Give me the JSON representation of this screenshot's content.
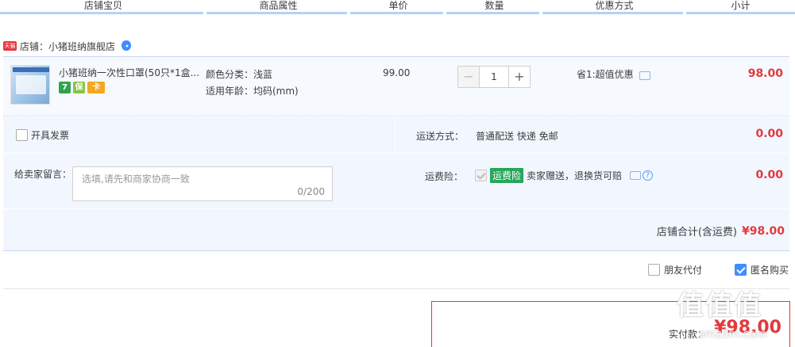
{
  "header": {
    "columns": [
      "店铺宝贝",
      "商品属性",
      "单价",
      "数量",
      "优惠方式",
      "小计"
    ]
  },
  "shop": {
    "badge": "天猫",
    "name": "店铺：小猪班纳旗舰店"
  },
  "item": {
    "title": "小猪班纳一次性口罩(50只*1盒...",
    "badges": [
      "7",
      "保",
      "卡"
    ],
    "attr_color": "颜色分类：浅蓝",
    "attr_age": "适用年龄：均码(mm)",
    "unit_price": "99.00",
    "quantity": "1",
    "minus": "−",
    "plus": "+",
    "promo": "省1:超值优惠",
    "subtotal": "98.00"
  },
  "options": {
    "invoice_label": "开具发票",
    "delivery_label": "运送方式：",
    "delivery_value": "普通配送 快递 免邮",
    "delivery_fee": "0.00",
    "message_label": "给卖家留言：",
    "message_placeholder": "选填,请先和商家协商一致",
    "message_count": "0/200",
    "insurance_label": "运费险：",
    "insurance_tag": "运费险",
    "insurance_text": "卖家赠送，退换货可赔",
    "insurance_help": "?",
    "insurance_fee": "0.00",
    "total_label": "店铺合计(含运费)",
    "total_value": "¥98.00"
  },
  "footer": {
    "friend_pay": "朋友代付",
    "anonymous": "匿名购买",
    "pay_label": "实付款：",
    "pay_value": "¥98.00"
  },
  "watermark": {
    "main": "值值值",
    "sub": "smzdm.com"
  },
  "colors": {
    "accent_red": "#e4393c",
    "header_bar": "#b2d1ff",
    "panel_bg": "#f2f7ff",
    "check_blue": "#3f8dff",
    "insurance_green": "#26a65b"
  }
}
